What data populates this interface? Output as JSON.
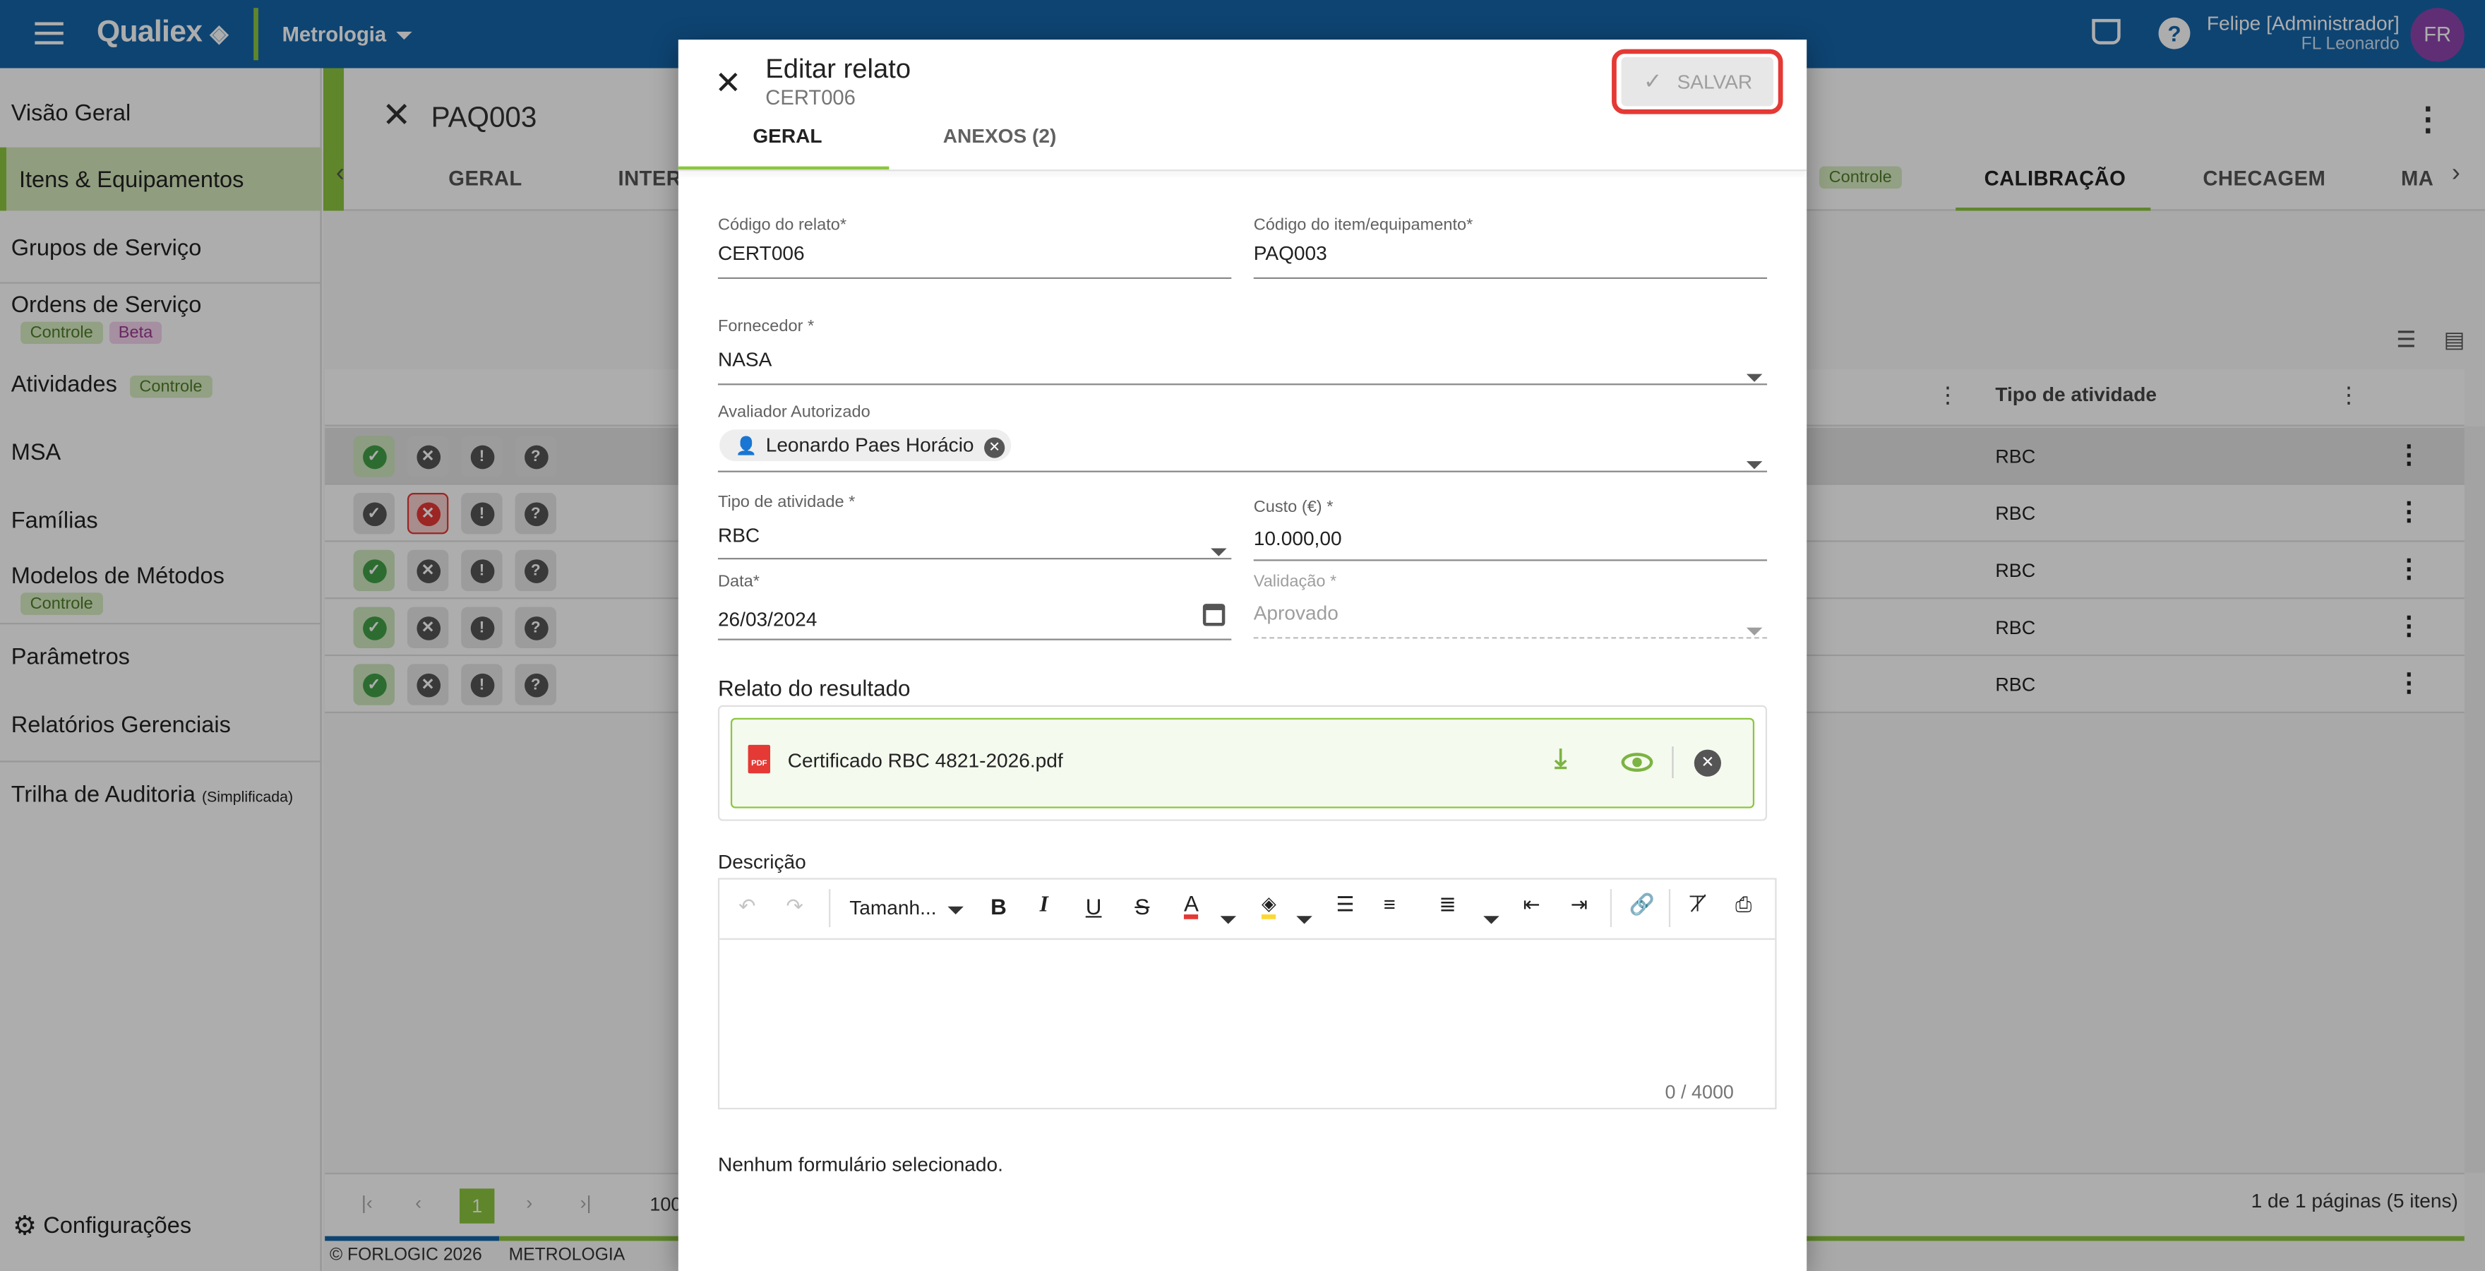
{
  "topbar": {
    "brand": "Qualiex",
    "module": "Metrologia",
    "user_name": "Felipe [Administrador]",
    "user_org": "FL Leonardo",
    "avatar": "FR"
  },
  "sidebar": {
    "items": [
      {
        "label": "Visão Geral"
      },
      {
        "label": "Itens & Equipamentos"
      },
      {
        "label": "Grupos de Serviço"
      },
      {
        "label": "Ordens de Serviço",
        "chips": [
          "Controle",
          "Beta"
        ]
      },
      {
        "label": "Atividades",
        "chips": [
          "Controle"
        ]
      },
      {
        "label": "MSA"
      },
      {
        "label": "Famílias"
      },
      {
        "label": "Modelos de Métodos",
        "chips": [
          "Controle"
        ]
      },
      {
        "label": "Parâmetros"
      },
      {
        "label": "Relatórios Gerenciais"
      },
      {
        "label": "Trilha de Auditoria",
        "suffix": "(Simplificada)"
      }
    ],
    "settings": "Configurações"
  },
  "page": {
    "title": "PAQ003",
    "tabs": [
      "GERAL",
      "INTERV",
      "Controle",
      "CALIBRAÇÃO",
      "CHECAGEM",
      "MA"
    ]
  },
  "table": {
    "col_type": "Tipo de atividade",
    "rows": [
      "RBC",
      "RBC",
      "RBC",
      "RBC",
      "RBC"
    ],
    "pagination": "1 de 1 páginas (5 itens)",
    "page": "1",
    "per_page": "100"
  },
  "footer": {
    "copyright": "© FORLOGIC 2026",
    "module": "METROLOGIA"
  },
  "modal": {
    "title": "Editar relato",
    "subtitle": "CERT006",
    "save_label": "SALVAR",
    "tabs": [
      "GERAL",
      "ANEXOS (2)"
    ],
    "fields": {
      "codigo_relato_label": "Código do relato*",
      "codigo_relato": "CERT006",
      "codigo_item_label": "Código do item/equipamento*",
      "codigo_item": "PAQ003",
      "fornecedor_label": "Fornecedor *",
      "fornecedor": "NASA",
      "avaliador_label": "Avaliador Autorizado",
      "avaliador": "Leonardo Paes Horácio",
      "tipo_label": "Tipo de atividade *",
      "tipo": "RBC",
      "custo_label": "Custo (€) *",
      "custo": "10.000,00",
      "data_label": "Data*",
      "data": "26/03/2024",
      "validacao_label": "Validação *",
      "validacao": "Aprovado"
    },
    "relato_title": "Relato do resultado",
    "file_name": "Certificado RBC 4821-2026.pdf",
    "descricao_label": "Descrição",
    "font_size": "Tamanh...",
    "counter": "0 / 4000",
    "no_form": "Nenhum formulário selecionado."
  },
  "colors": {
    "primary": "#1565a8",
    "accent": "#8cc63f",
    "danger": "#e53935"
  }
}
